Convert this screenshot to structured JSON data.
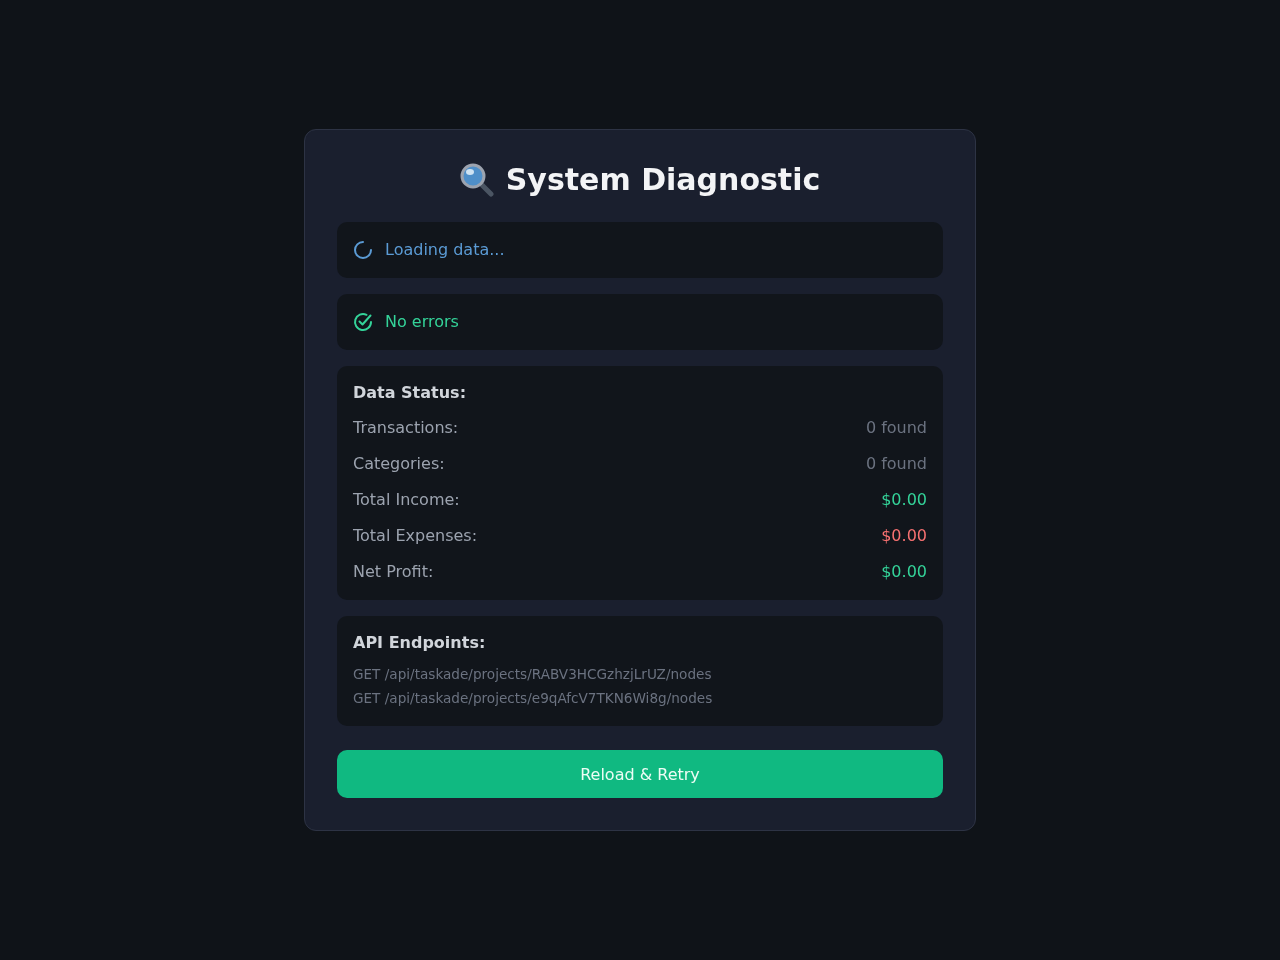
{
  "title": "System Diagnostic",
  "statuses": [
    {
      "kind": "loading",
      "text": "Loading data..."
    },
    {
      "kind": "success",
      "text": "No errors"
    }
  ],
  "data_status": {
    "heading": "Data Status:",
    "rows": [
      {
        "label": "Transactions:",
        "value": "0 found",
        "color": "#6b7280"
      },
      {
        "label": "Categories:",
        "value": "0 found",
        "color": "#6b7280"
      },
      {
        "label": "Total Income:",
        "value": "$0.00",
        "color": "#34d399"
      },
      {
        "label": "Total Expenses:",
        "value": "$0.00",
        "color": "#f87171"
      },
      {
        "label": "Net Profit:",
        "value": "$0.00",
        "color": "#34d399"
      }
    ]
  },
  "api_endpoints": {
    "heading": "API Endpoints:",
    "items": [
      "GET /api/taskade/projects/RABV3HCGzhzjLrUZ/nodes",
      "GET /api/taskade/projects/e9qAfcV7TKN6Wi8g/nodes"
    ]
  },
  "button": "Reload & Retry"
}
